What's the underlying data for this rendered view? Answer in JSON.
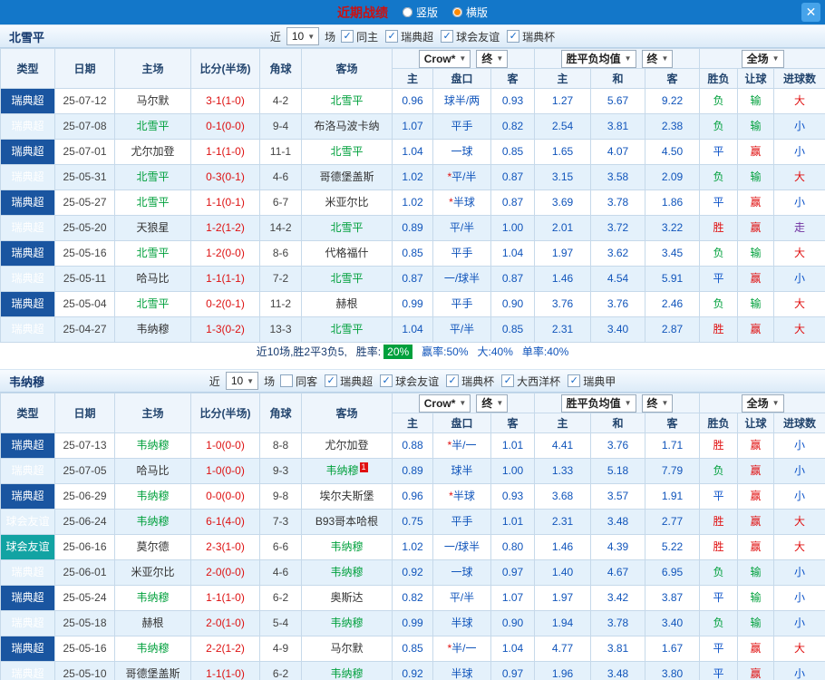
{
  "topbar": {
    "title": "近期战绩",
    "layout_options": [
      {
        "label": "竖版",
        "selected": false
      },
      {
        "label": "横版",
        "selected": true
      }
    ],
    "close_label": "✕"
  },
  "columns": {
    "left": [
      "类型",
      "日期",
      "主场",
      "比分(半场)",
      "角球",
      "客场"
    ],
    "asia": [
      "主",
      "盘口",
      "客"
    ],
    "europe": [
      "主",
      "和",
      "客"
    ],
    "result": [
      "胜负",
      "让球",
      "进球数"
    ]
  },
  "colors": {
    "league_super": "#1a55a0",
    "league_friendly": "#12a3a3",
    "focus_team": "#00a03c",
    "win": "#e01111",
    "draw": "#0b52c8",
    "lose": "#00a03c",
    "topbar": "#1377c9"
  },
  "sections": [
    {
      "team": "北雪平",
      "filter": {
        "near_label": "近",
        "count": "10",
        "matches_label": "场",
        "checkboxes": [
          {
            "label": "同主",
            "checked": true
          },
          {
            "label": "瑞典超",
            "checked": true
          },
          {
            "label": "球会友谊",
            "checked": true
          },
          {
            "label": "瑞典杯",
            "checked": true
          }
        ]
      },
      "dropdowns": {
        "company": "Crow*",
        "company_final": "终",
        "europe": "胜平负均值",
        "europe_final": "终",
        "scope": "全场"
      },
      "rows": [
        {
          "league": "瑞典超",
          "date": "25-07-12",
          "home": "马尔默",
          "score": "3-1(1-0)",
          "corner": "4-2",
          "away": "北雪平",
          "odds": [
            "0.96",
            "0.93"
          ],
          "handicap": "球半/两",
          "euro": [
            "1.27",
            "5.67",
            "9.22"
          ],
          "result": "负",
          "let": "输",
          "goal": "大"
        },
        {
          "league": "瑞典超",
          "date": "25-07-08",
          "home": "北雪平",
          "score": "0-1(0-0)",
          "corner": "9-4",
          "away": "布洛马波卡纳",
          "odds": [
            "1.07",
            "0.82"
          ],
          "handicap": "平手",
          "euro": [
            "2.54",
            "3.81",
            "2.38"
          ],
          "result": "负",
          "let": "输",
          "goal": "小"
        },
        {
          "league": "瑞典超",
          "date": "25-07-01",
          "home": "尤尔加登",
          "score": "1-1(1-0)",
          "corner": "11-1",
          "away": "北雪平",
          "odds": [
            "1.04",
            "0.85"
          ],
          "handicap": "一球",
          "euro": [
            "1.65",
            "4.07",
            "4.50"
          ],
          "result": "平",
          "let": "赢",
          "goal": "小"
        },
        {
          "league": "瑞典超",
          "date": "25-05-31",
          "home": "北雪平",
          "score": "0-3(0-1)",
          "corner": "4-6",
          "away": "哥德堡盖斯",
          "odds": [
            "1.02",
            "0.87"
          ],
          "handicap": "*平/半",
          "euro": [
            "3.15",
            "3.58",
            "2.09"
          ],
          "result": "负",
          "let": "输",
          "goal": "大"
        },
        {
          "league": "瑞典超",
          "date": "25-05-27",
          "home": "北雪平",
          "score": "1-1(0-1)",
          "corner": "6-7",
          "away": "米亚尔比",
          "odds": [
            "1.02",
            "0.87"
          ],
          "handicap": "*半球",
          "euro": [
            "3.69",
            "3.78",
            "1.86"
          ],
          "result": "平",
          "let": "赢",
          "goal": "小"
        },
        {
          "league": "瑞典超",
          "date": "25-05-20",
          "home": "天狼星",
          "score": "1-2(1-2)",
          "corner": "14-2",
          "away": "北雪平",
          "odds": [
            "0.89",
            "1.00"
          ],
          "handicap": "平/半",
          "euro": [
            "2.01",
            "3.72",
            "3.22"
          ],
          "result": "胜",
          "let": "赢",
          "goal": "走"
        },
        {
          "league": "瑞典超",
          "date": "25-05-16",
          "home": "北雪平",
          "score": "1-2(0-0)",
          "corner": "8-6",
          "away": "代格福什",
          "odds": [
            "0.85",
            "1.04"
          ],
          "handicap": "平手",
          "euro": [
            "1.97",
            "3.62",
            "3.45"
          ],
          "result": "负",
          "let": "输",
          "goal": "大"
        },
        {
          "league": "瑞典超",
          "date": "25-05-11",
          "home": "哈马比",
          "score": "1-1(1-1)",
          "corner": "7-2",
          "away": "北雪平",
          "odds": [
            "0.87",
            "0.87"
          ],
          "handicap": "一/球半",
          "euro": [
            "1.46",
            "4.54",
            "5.91"
          ],
          "result": "平",
          "let": "赢",
          "goal": "小"
        },
        {
          "league": "瑞典超",
          "date": "25-05-04",
          "home": "北雪平",
          "score": "0-2(0-1)",
          "corner": "11-2",
          "away": "赫根",
          "odds": [
            "0.99",
            "0.90"
          ],
          "handicap": "平手",
          "euro": [
            "3.76",
            "3.76",
            "2.46"
          ],
          "result": "负",
          "let": "输",
          "goal": "大"
        },
        {
          "league": "瑞典超",
          "date": "25-04-27",
          "home": "韦纳穆",
          "score": "1-3(0-2)",
          "corner": "13-3",
          "away": "北雪平",
          "odds": [
            "1.04",
            "0.85"
          ],
          "handicap": "平/半",
          "euro": [
            "2.31",
            "3.40",
            "2.87"
          ],
          "result": "胜",
          "let": "赢",
          "goal": "大"
        }
      ],
      "summary": {
        "record": "近10场,胜2平3负5,",
        "win_rate_label": "胜率:",
        "win_rate": "20%",
        "stats": [
          "赢率:50%",
          "大:40%",
          "单率:40%"
        ]
      }
    },
    {
      "team": "韦纳穆",
      "filter": {
        "near_label": "近",
        "count": "10",
        "matches_label": "场",
        "checkboxes": [
          {
            "label": "同客",
            "checked": false
          },
          {
            "label": "瑞典超",
            "checked": true
          },
          {
            "label": "球会友谊",
            "checked": true
          },
          {
            "label": "瑞典杯",
            "checked": true
          },
          {
            "label": "大西洋杯",
            "checked": true
          },
          {
            "label": "瑞典甲",
            "checked": true
          }
        ]
      },
      "dropdowns": {
        "company": "Crow*",
        "company_final": "终",
        "europe": "胜平负均值",
        "europe_final": "终",
        "scope": "全场"
      },
      "rows": [
        {
          "league": "瑞典超",
          "date": "25-07-13",
          "home": "韦纳穆",
          "score": "1-0(0-0)",
          "corner": "8-8",
          "away": "尤尔加登",
          "odds": [
            "0.88",
            "1.01"
          ],
          "handicap": "*半/一",
          "euro": [
            "4.41",
            "3.76",
            "1.71"
          ],
          "result": "胜",
          "let": "赢",
          "goal": "小"
        },
        {
          "league": "瑞典超",
          "date": "25-07-05",
          "home": "哈马比",
          "score": "1-0(0-0)",
          "corner": "9-3",
          "away": "韦纳穆",
          "away_badge": "1",
          "odds": [
            "0.89",
            "1.00"
          ],
          "handicap": "球半",
          "euro": [
            "1.33",
            "5.18",
            "7.79"
          ],
          "result": "负",
          "let": "赢",
          "goal": "小"
        },
        {
          "league": "瑞典超",
          "date": "25-06-29",
          "home": "韦纳穆",
          "score": "0-0(0-0)",
          "corner": "9-8",
          "away": "埃尔夫斯堡",
          "odds": [
            "0.96",
            "0.93"
          ],
          "handicap": "*半球",
          "euro": [
            "3.68",
            "3.57",
            "1.91"
          ],
          "result": "平",
          "let": "赢",
          "goal": "小"
        },
        {
          "league": "球会友谊",
          "date": "25-06-24",
          "home": "韦纳穆",
          "score": "6-1(4-0)",
          "corner": "7-3",
          "away": "B93哥本哈根",
          "odds": [
            "0.75",
            "1.01"
          ],
          "handicap": "平手",
          "euro": [
            "2.31",
            "3.48",
            "2.77"
          ],
          "result": "胜",
          "let": "赢",
          "goal": "大"
        },
        {
          "league": "球会友谊",
          "date": "25-06-16",
          "home": "莫尔德",
          "score": "2-3(1-0)",
          "corner": "6-6",
          "away": "韦纳穆",
          "odds": [
            "1.02",
            "0.80"
          ],
          "handicap": "一/球半",
          "euro": [
            "1.46",
            "4.39",
            "5.22"
          ],
          "result": "胜",
          "let": "赢",
          "goal": "大"
        },
        {
          "league": "瑞典超",
          "date": "25-06-01",
          "home": "米亚尔比",
          "score": "2-0(0-0)",
          "corner": "4-6",
          "away": "韦纳穆",
          "odds": [
            "0.92",
            "0.97"
          ],
          "handicap": "一球",
          "euro": [
            "1.40",
            "4.67",
            "6.95"
          ],
          "result": "负",
          "let": "输",
          "goal": "小"
        },
        {
          "league": "瑞典超",
          "date": "25-05-24",
          "home": "韦纳穆",
          "score": "1-1(1-0)",
          "corner": "6-2",
          "away": "奥斯达",
          "odds": [
            "0.82",
            "1.07"
          ],
          "handicap": "平/半",
          "euro": [
            "1.97",
            "3.42",
            "3.87"
          ],
          "result": "平",
          "let": "输",
          "goal": "小"
        },
        {
          "league": "瑞典超",
          "date": "25-05-18",
          "home": "赫根",
          "score": "2-0(1-0)",
          "corner": "5-4",
          "away": "韦纳穆",
          "odds": [
            "0.99",
            "0.90"
          ],
          "handicap": "半球",
          "euro": [
            "1.94",
            "3.78",
            "3.40"
          ],
          "result": "负",
          "let": "输",
          "goal": "小"
        },
        {
          "league": "瑞典超",
          "date": "25-05-16",
          "home": "韦纳穆",
          "score": "2-2(1-2)",
          "corner": "4-9",
          "away": "马尔默",
          "odds": [
            "0.85",
            "1.04"
          ],
          "handicap": "*半/一",
          "euro": [
            "4.77",
            "3.81",
            "1.67"
          ],
          "result": "平",
          "let": "赢",
          "goal": "大"
        },
        {
          "league": "瑞典超",
          "date": "25-05-10",
          "home": "哥德堡盖斯",
          "score": "1-1(1-0)",
          "corner": "6-2",
          "away": "韦纳穆",
          "odds": [
            "0.92",
            "0.97"
          ],
          "handicap": "半球",
          "euro": [
            "1.96",
            "3.48",
            "3.80"
          ],
          "result": "平",
          "let": "赢",
          "goal": "小"
        }
      ]
    }
  ]
}
